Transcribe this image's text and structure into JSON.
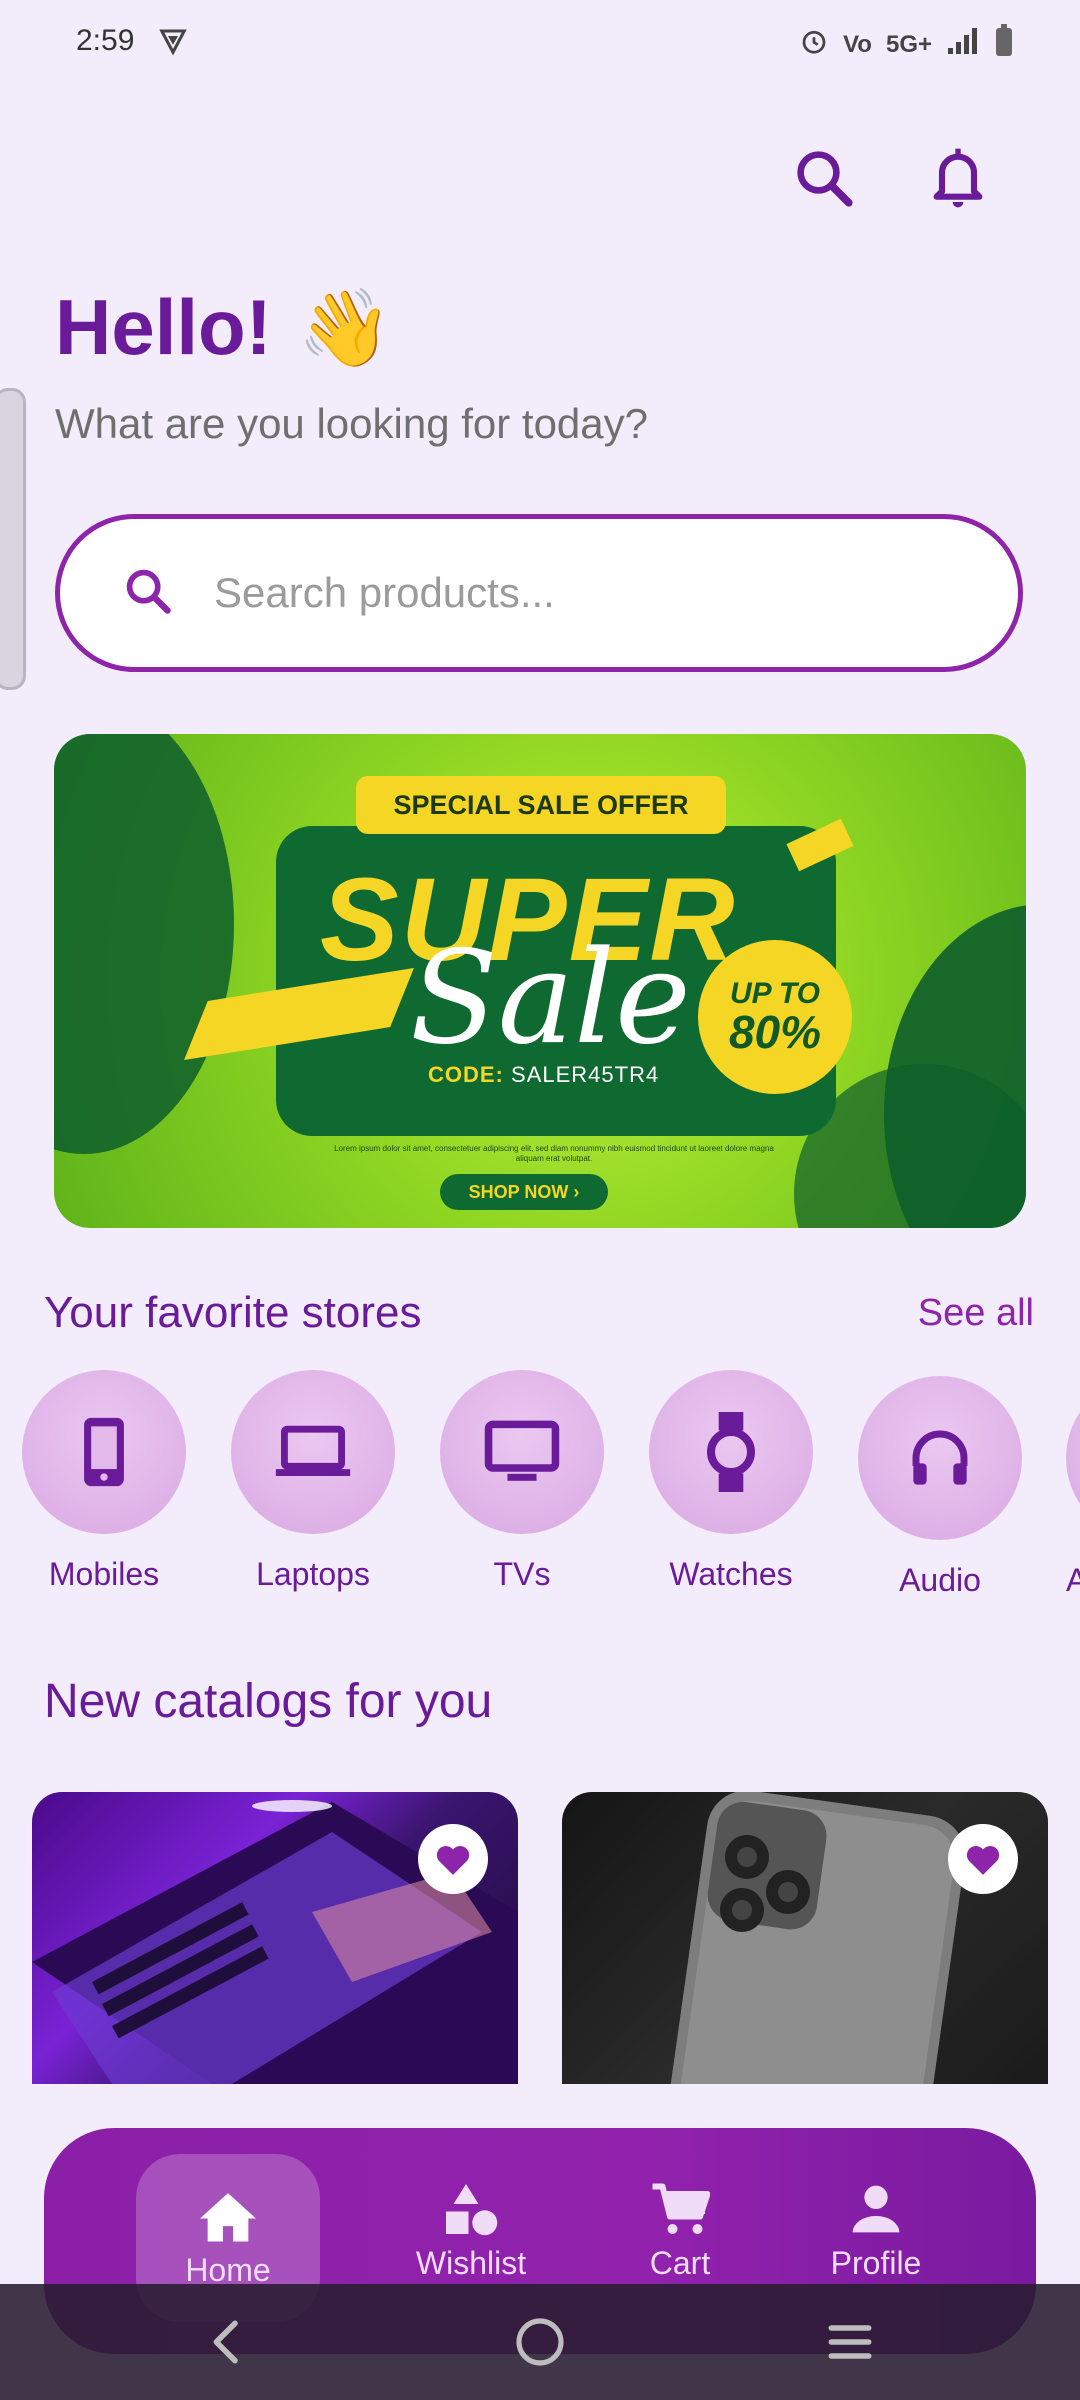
{
  "status": {
    "time": "2:59",
    "network": "5G+"
  },
  "greeting": {
    "title": "Hello!",
    "emoji": "👋",
    "subtitle": "What are you looking for today?"
  },
  "search": {
    "placeholder": "Search products..."
  },
  "banner": {
    "tag": "SPECIAL SALE OFFER",
    "headline1": "SUPER",
    "headline2": "Sale",
    "badge_top": "UP TO",
    "badge_value": "80%",
    "code_label": "CODE:",
    "code_value": "SALER45TR4",
    "fine_print": "Lorem ipsum dolor sit amet, consectetuer adipiscing elit, sed diam nonummy nibh euismod tincidunt ut laoreet dolore magna aliquam erat volutpat.",
    "cta": "SHOP NOW ›"
  },
  "stores": {
    "title": "Your favorite stores",
    "see_all": "See all",
    "items": [
      {
        "label": "Mobiles",
        "icon": "smartphone-icon"
      },
      {
        "label": "Laptops",
        "icon": "laptop-icon"
      },
      {
        "label": "TVs",
        "icon": "tv-icon"
      },
      {
        "label": "Watches",
        "icon": "watch-icon"
      },
      {
        "label": "Audio",
        "icon": "headphones-icon"
      },
      {
        "label": "A",
        "icon": "partial-store-icon"
      }
    ]
  },
  "catalogs": {
    "title": "New catalogs for you"
  },
  "nav": {
    "items": [
      {
        "label": "Home",
        "icon": "home-icon",
        "active": true
      },
      {
        "label": "Wishlist",
        "icon": "shapes-icon"
      },
      {
        "label": "Cart",
        "icon": "cart-icon"
      },
      {
        "label": "Profile",
        "icon": "person-icon"
      }
    ]
  },
  "colors": {
    "primary": "#6a1b9a",
    "accent": "#8e24aa",
    "background": "#f3ecfb"
  }
}
